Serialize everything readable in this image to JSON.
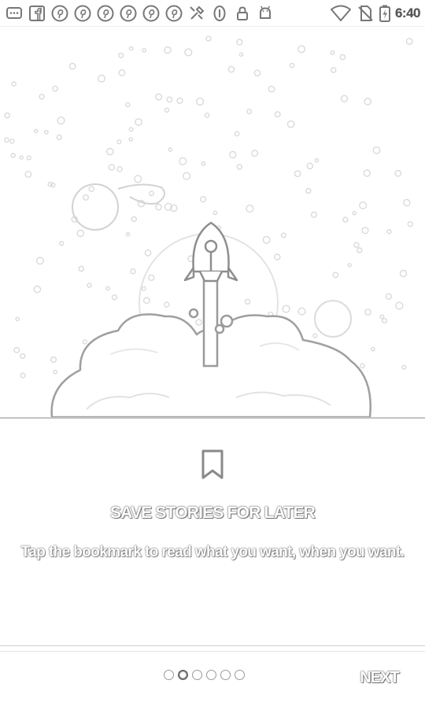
{
  "status_bar": {
    "left_icons": [
      "messages-icon",
      "facebook-icon",
      "pinterest-icon",
      "pinterest-icon",
      "pinterest-icon",
      "pinterest-icon",
      "pinterest-icon",
      "pinterest-icon",
      "tools-icon",
      "sync-icon",
      "lock-icon",
      "android-icon"
    ],
    "right_icons": [
      "wifi-icon",
      "no-sim-icon",
      "battery-charging-icon"
    ],
    "time": "6:40"
  },
  "onboarding": {
    "illustration": "rocket-launch-illustration",
    "feature_icon": "bookmark-icon",
    "title": "SAVE STORIES FOR LATER",
    "description": "Tap the bookmark to read what you want, when you want."
  },
  "pager": {
    "total_pages": 6,
    "current_page": 2
  },
  "footer": {
    "next_label": "NEXT"
  }
}
